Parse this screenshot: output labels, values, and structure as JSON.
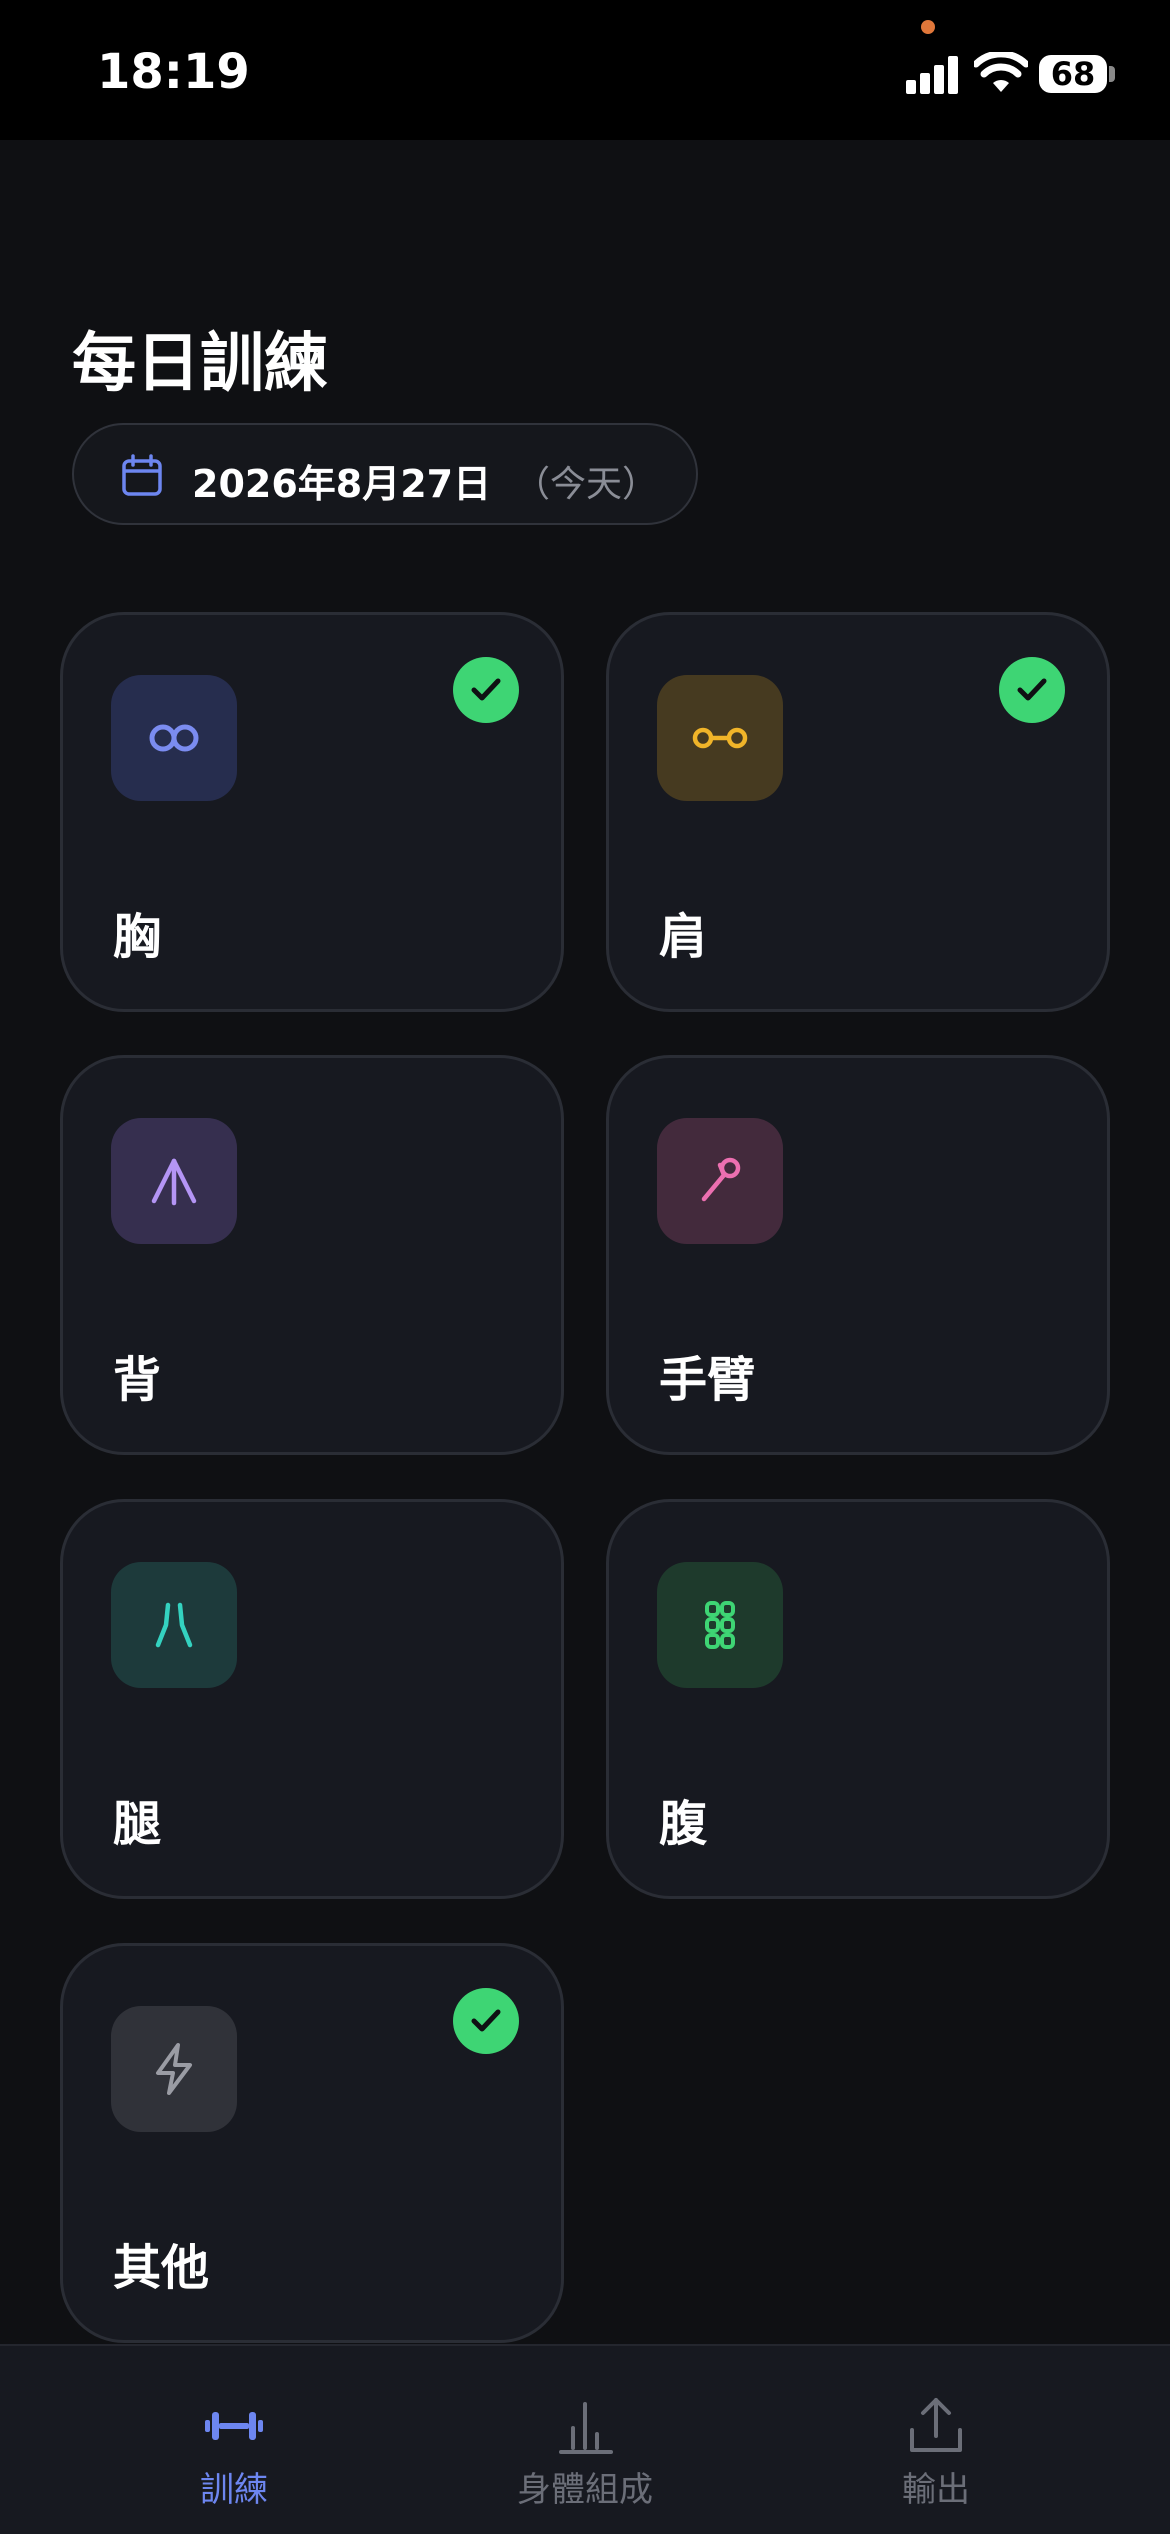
{
  "status_bar": {
    "time": "18:19",
    "battery": "68"
  },
  "header": {
    "title": "每日訓練",
    "date_label": "2026年8月27日",
    "date_sub": "（今天）"
  },
  "categories": [
    {
      "label": "胸",
      "icon": "chest-icon",
      "completed": true,
      "accent": "#7b8cf0",
      "icon_bg": "#262d4e"
    },
    {
      "label": "肩",
      "icon": "shoulder-icon",
      "completed": true,
      "accent": "#f0b429",
      "icon_bg": "#463a20"
    },
    {
      "label": "背",
      "icon": "back-icon",
      "completed": false,
      "accent": "#b495f5",
      "icon_bg": "#362f4f"
    },
    {
      "label": "手臂",
      "icon": "arm-icon",
      "completed": false,
      "accent": "#ec6fb0",
      "icon_bg": "#432a3c"
    },
    {
      "label": "腿",
      "icon": "legs-icon",
      "completed": false,
      "accent": "#34d2c0",
      "icon_bg": "#1d3a3b"
    },
    {
      "label": "腹",
      "icon": "abs-icon",
      "completed": false,
      "accent": "#3ed574",
      "icon_bg": "#1e3a2c"
    },
    {
      "label": "其他",
      "icon": "lightning-icon",
      "completed": true,
      "accent": "#9a9ca4",
      "icon_bg": "#303239"
    }
  ],
  "tabs": [
    {
      "label": "訓練",
      "icon": "dumbbell-icon",
      "active": true
    },
    {
      "label": "身體組成",
      "icon": "bar-chart-icon",
      "active": false
    },
    {
      "label": "輸出",
      "icon": "share-icon",
      "active": false
    }
  ]
}
